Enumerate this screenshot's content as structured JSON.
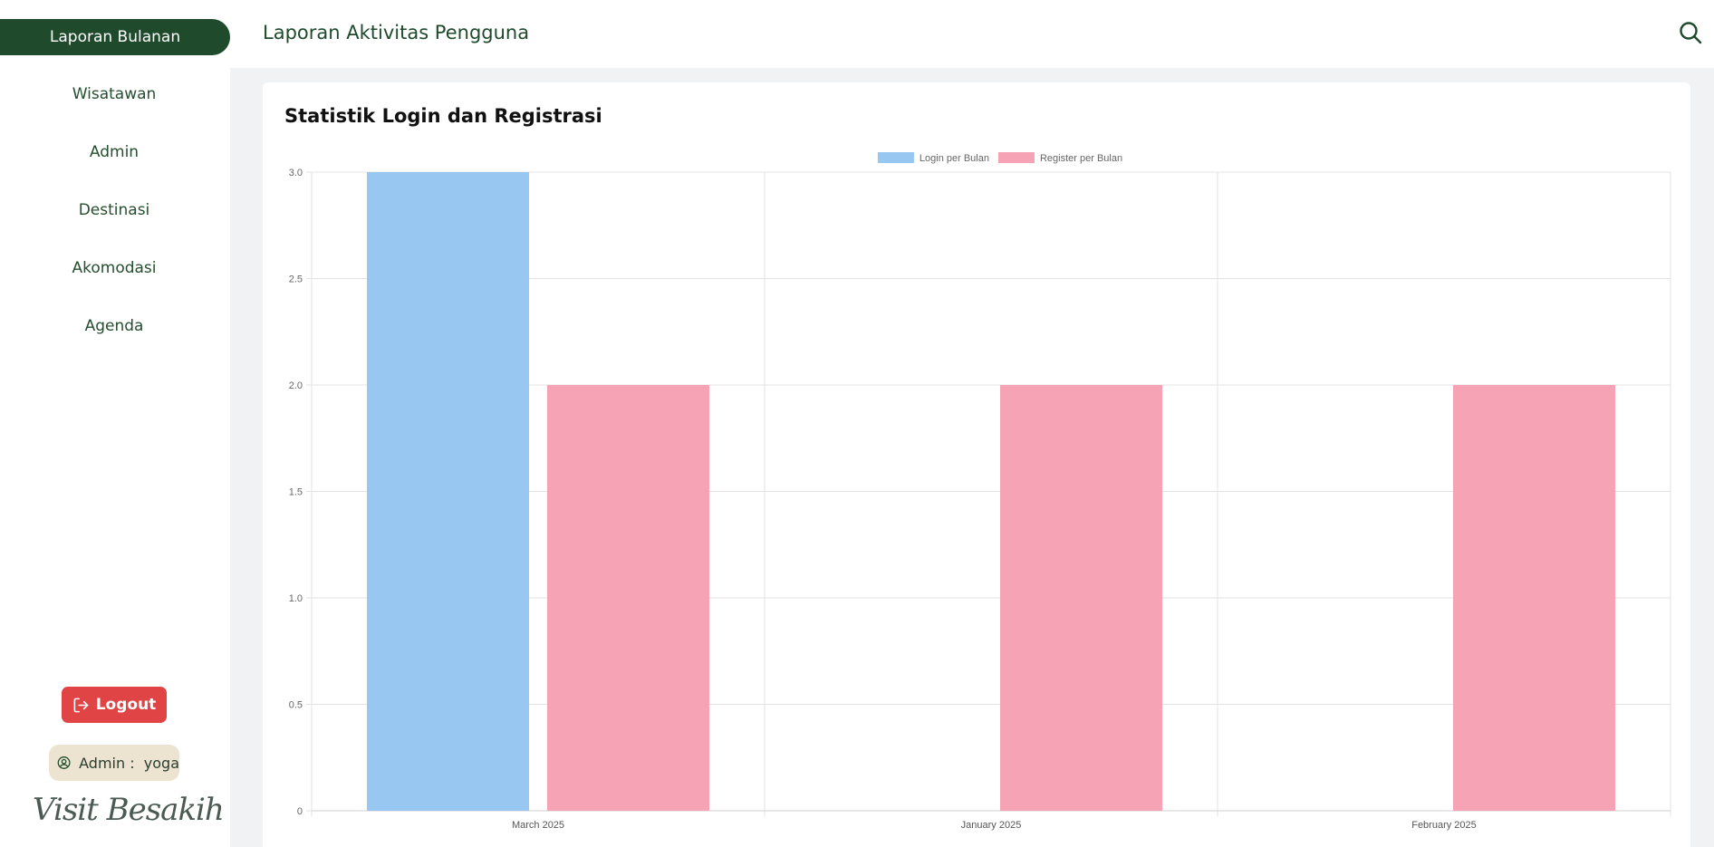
{
  "sidebar": {
    "active_item": "Laporan Bulanan",
    "items": [
      "Wisatawan",
      "Admin",
      "Destinasi",
      "Akomodasi",
      "Agenda"
    ],
    "logout_label": "Logout",
    "user_label": "Admin :  yoga",
    "brand_text": "Visit Besakih"
  },
  "header": {
    "title": "Laporan Aktivitas Pengguna"
  },
  "card": {
    "title": "Statistik Login dan Registrasi"
  },
  "colors": {
    "primary": "#1f4a2c",
    "logout": "#e04444",
    "login_series": "#98c7f2",
    "register_series": "#f6a3b5"
  },
  "chart_data": {
    "type": "bar",
    "categories": [
      "March 2025",
      "January 2025",
      "February 2025"
    ],
    "series": [
      {
        "name": "Login per Bulan",
        "values": [
          3,
          0,
          0
        ]
      },
      {
        "name": "Register per Bulan",
        "values": [
          2,
          2,
          2
        ]
      }
    ],
    "ylim": [
      0,
      3
    ],
    "yticks": [
      "0",
      "0.5",
      "1.0",
      "1.5",
      "2.0",
      "2.5",
      "3.0"
    ],
    "grid": true,
    "legend": "top-center"
  }
}
